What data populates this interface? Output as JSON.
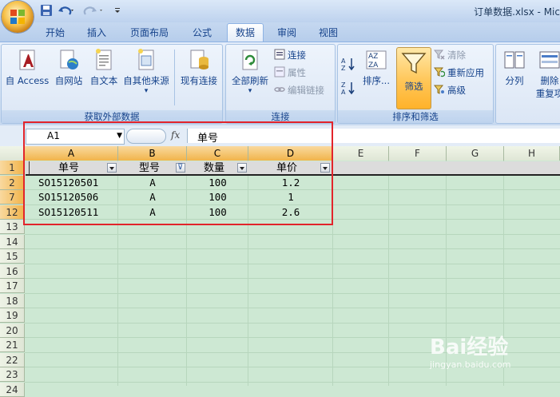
{
  "window": {
    "title": "订单数据.xlsx - Mic"
  },
  "tabs": [
    "开始",
    "插入",
    "页面布局",
    "公式",
    "数据",
    "审阅",
    "视图"
  ],
  "active_tab": "数据",
  "ribbon": {
    "external_data": {
      "label": "获取外部数据",
      "access": "自 Access",
      "web": "自网站",
      "text": "自文本",
      "other": "自其他来源",
      "existing": "现有连接"
    },
    "connections": {
      "label": "连接",
      "refresh_all": "全部刷新",
      "connections": "连接",
      "properties": "属性",
      "edit_links": "编辑链接"
    },
    "sort_filter": {
      "label": "排序和筛选",
      "sort": "排序...",
      "filter": "筛选",
      "clear": "清除",
      "reapply": "重新应用",
      "advanced": "高级"
    },
    "data_tools": {
      "split": "分列",
      "remove_dup_1": "删除",
      "remove_dup_2": "重复项"
    }
  },
  "formula_bar": {
    "name_box": "A1",
    "fx_label": "fx",
    "content": "单号"
  },
  "columns": [
    "A",
    "B",
    "C",
    "D",
    "E",
    "F",
    "G",
    "H"
  ],
  "rows": [
    "1",
    "2",
    "7",
    "12",
    "13",
    "14",
    "15",
    "16",
    "17",
    "18",
    "19",
    "20",
    "21",
    "22",
    "23",
    "24"
  ],
  "table": {
    "headers": [
      "单号",
      "型号",
      "数量",
      "单价"
    ],
    "filtered_column": "型号",
    "data": [
      [
        "SO15120501",
        "A",
        "100",
        "1.2"
      ],
      [
        "SO15120506",
        "A",
        "100",
        "1"
      ],
      [
        "SO15120511",
        "A",
        "100",
        "2.6"
      ]
    ]
  },
  "watermark": {
    "brand": "Bai经验",
    "url": "jingyan.baidu.com"
  },
  "colors": {
    "accent_red": "#e2242b",
    "sheet_bg": "#cde8d3",
    "selected_header": "#f1b44b"
  }
}
